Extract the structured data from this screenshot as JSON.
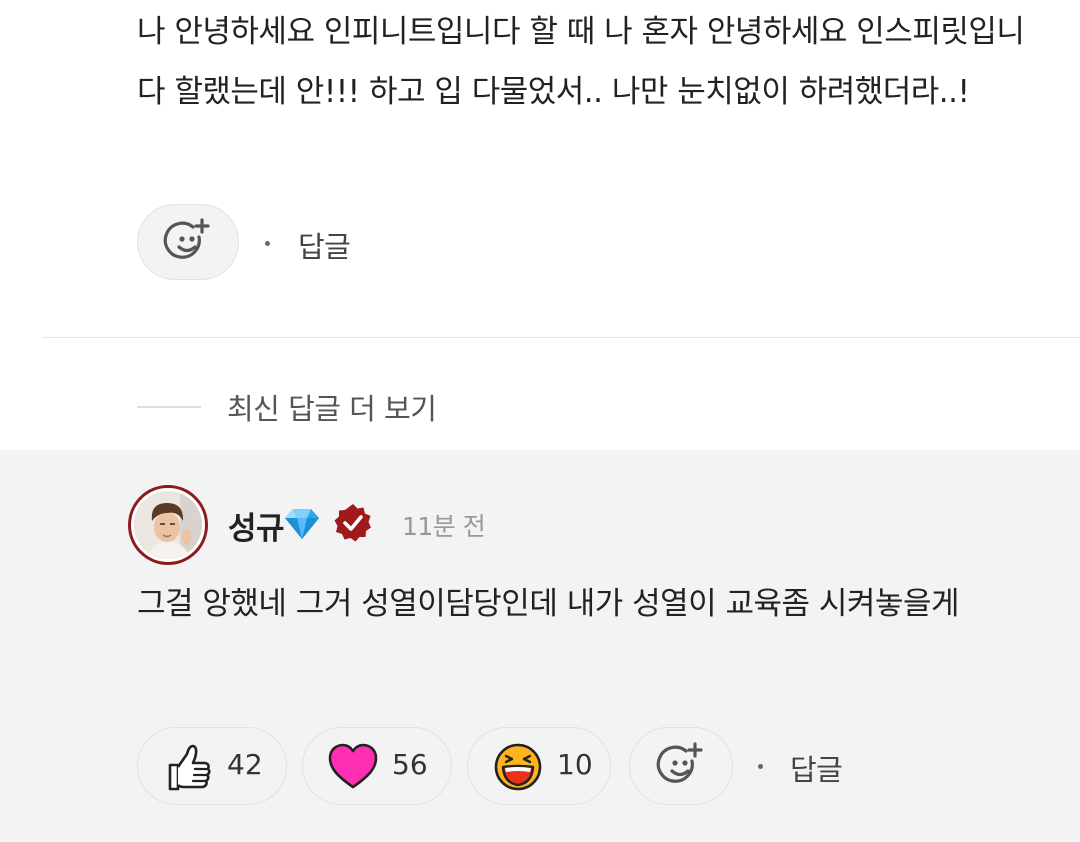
{
  "top_comment": {
    "text": "나 안녕하세요 인피니트입니다 할 때 나 혼자 안녕하세요 인스피릿입니다 할랬는데 안!!! 하고 입 다물었서.. 나만 눈치없이 하려했더라..!",
    "add_reaction_icon": "smiley-plus-icon",
    "reply_label": "답글"
  },
  "more_replies_label": "최신 답글 더 보기",
  "reply": {
    "author": "성규",
    "badge_icon": "diamond-icon",
    "verified_icon": "verified-badge-icon",
    "time": "11분 전",
    "text": "그걸 앙했네 그거 성열이담당인데 내가 성열이 교육좀 시켜놓을게",
    "reactions": [
      {
        "icon": "thumbs-up-icon",
        "count": "42"
      },
      {
        "icon": "heart-icon",
        "count": "56"
      },
      {
        "icon": "laughing-face-icon",
        "count": "10"
      }
    ],
    "add_reaction_icon": "smiley-plus-icon",
    "reply_label": "답글"
  },
  "colors": {
    "heart": "#ff2fb4",
    "laugh_face": "#ffb31c",
    "verified": "#a0191d",
    "diamond": "#29a8ef",
    "reply_background": "#f3f3f3"
  }
}
